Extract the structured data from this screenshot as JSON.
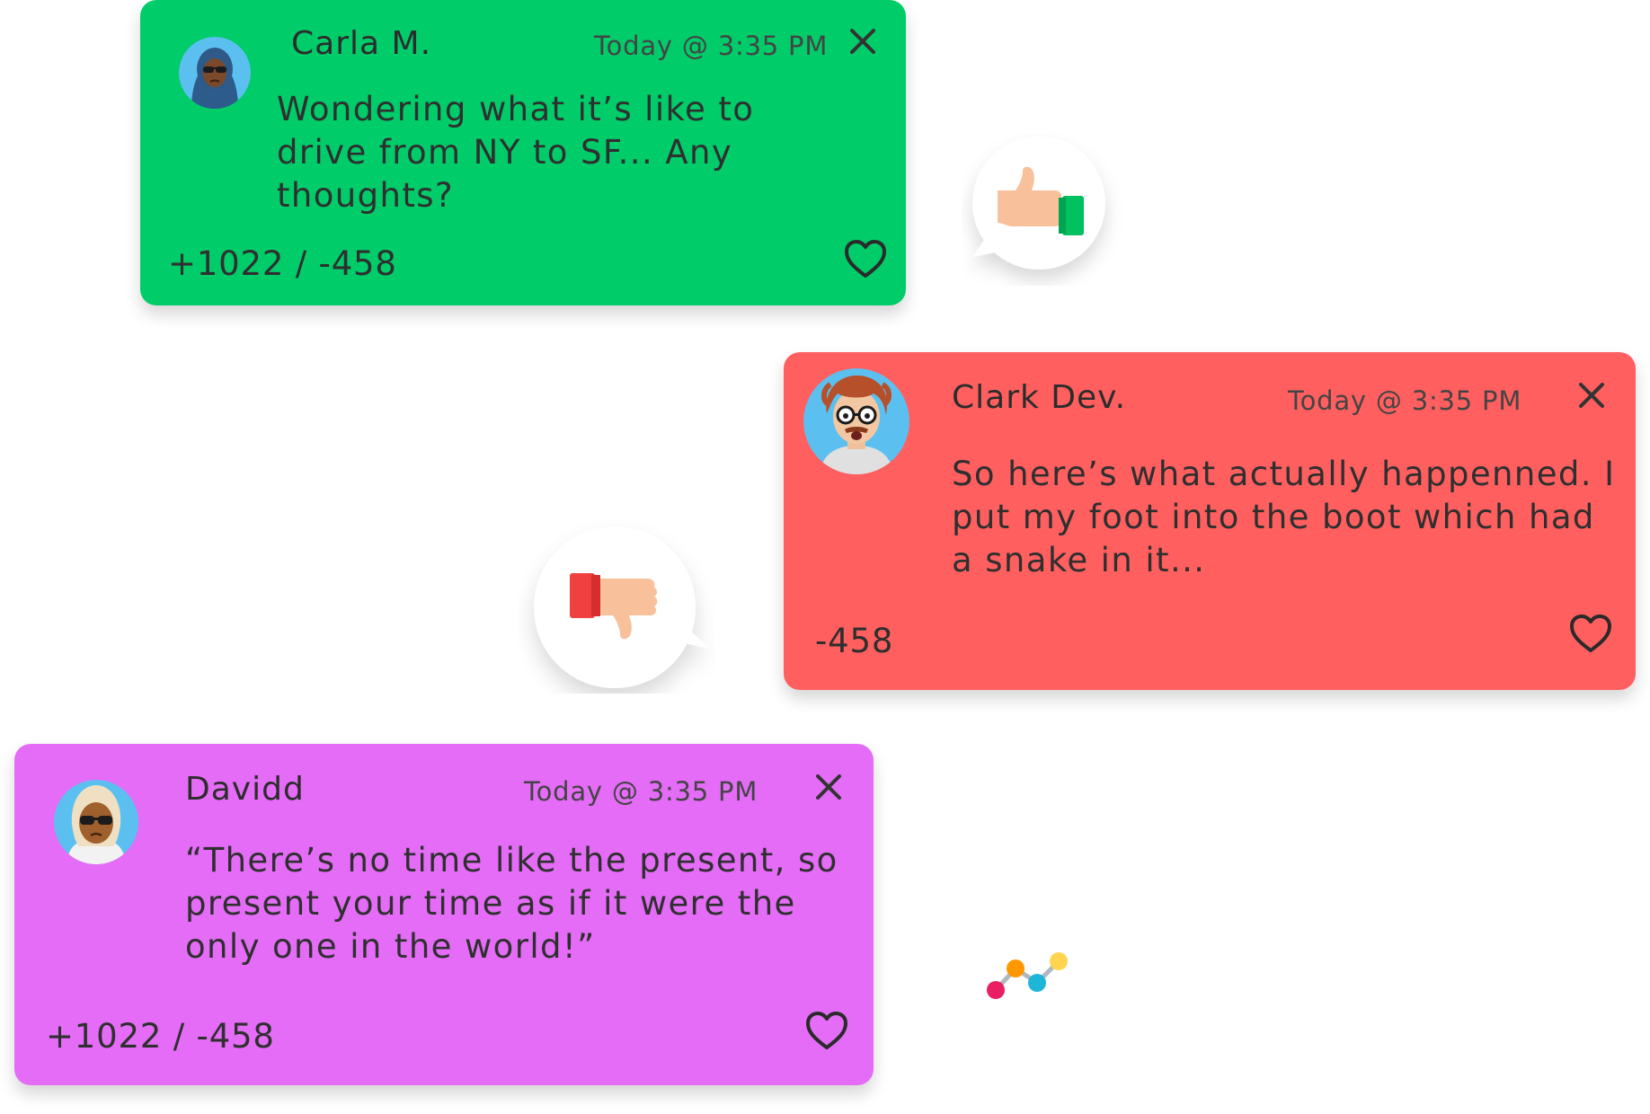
{
  "cards": [
    {
      "name": "Carla M.",
      "time": "Today @ 3:35 PM",
      "message": "Wondering what it’s like to drive from NY to SF... Any thoughts?",
      "votes": "+1022 / -458",
      "color": "#00cc6a"
    },
    {
      "name": "Clark Dev.",
      "time": "Today @ 3:35 PM",
      "message": "So here’s what actually happenned. I put my foot into the boot which had a snake in it...",
      "votes": "-458",
      "color": "#ff5f5f"
    },
    {
      "name": "Davidd",
      "time": "Today @ 3:35 PM",
      "message": "“There’s no time like the present, so present your time as if it were the only one in the world!”",
      "votes": "+1022 / -458",
      "color": "#e46cf7"
    }
  ],
  "icons": {
    "like_bubble": "thumbs-up-icon",
    "dislike_bubble": "thumbs-down-icon",
    "close": "close-icon",
    "favorite": "heart-icon",
    "decoration": "dots-line-icon"
  }
}
